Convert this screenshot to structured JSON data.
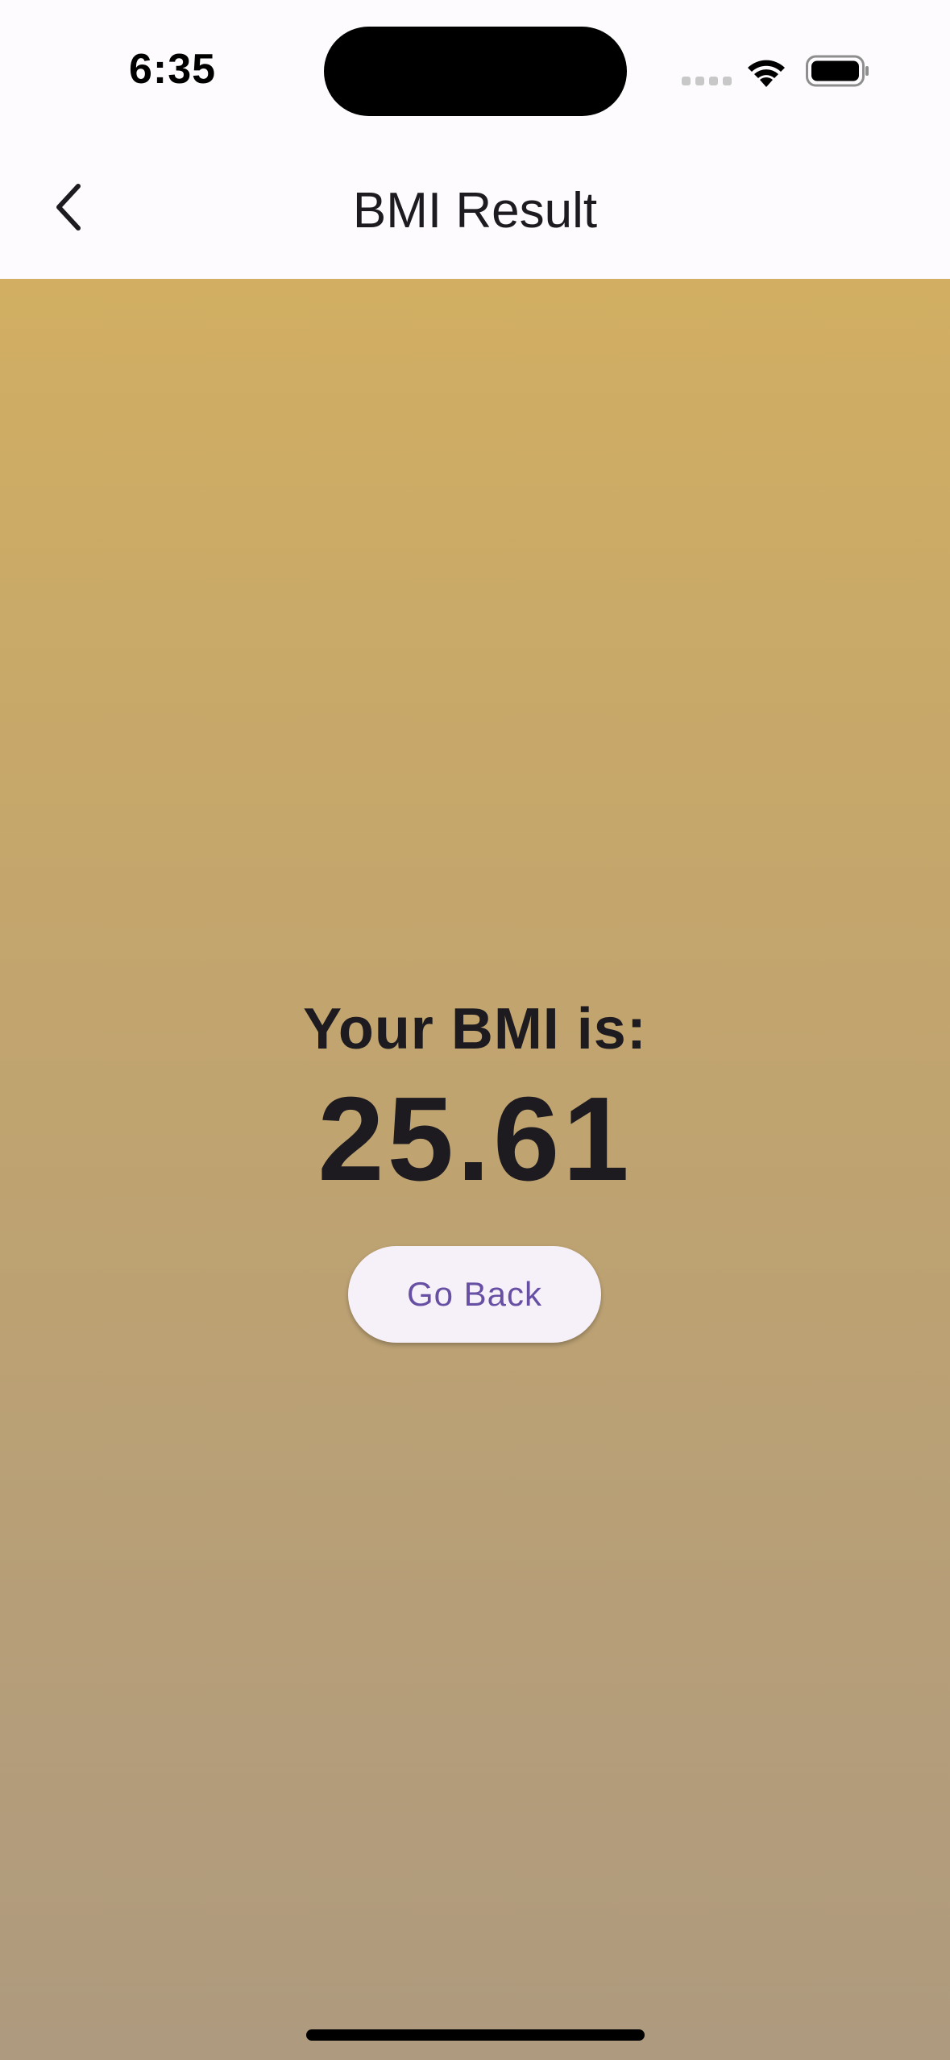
{
  "status_bar": {
    "time": "6:35"
  },
  "app_bar": {
    "title": "BMI Result",
    "back_icon": "chevron-left-icon"
  },
  "result": {
    "label": "Your BMI is:",
    "value": "25.61"
  },
  "actions": {
    "go_back_label": "Go Back"
  },
  "colors": {
    "gradient_top": "#d1ae62",
    "gradient_bottom": "#ae9a7e",
    "button_text": "#6750a4",
    "button_bg": "#f6f1f9"
  }
}
